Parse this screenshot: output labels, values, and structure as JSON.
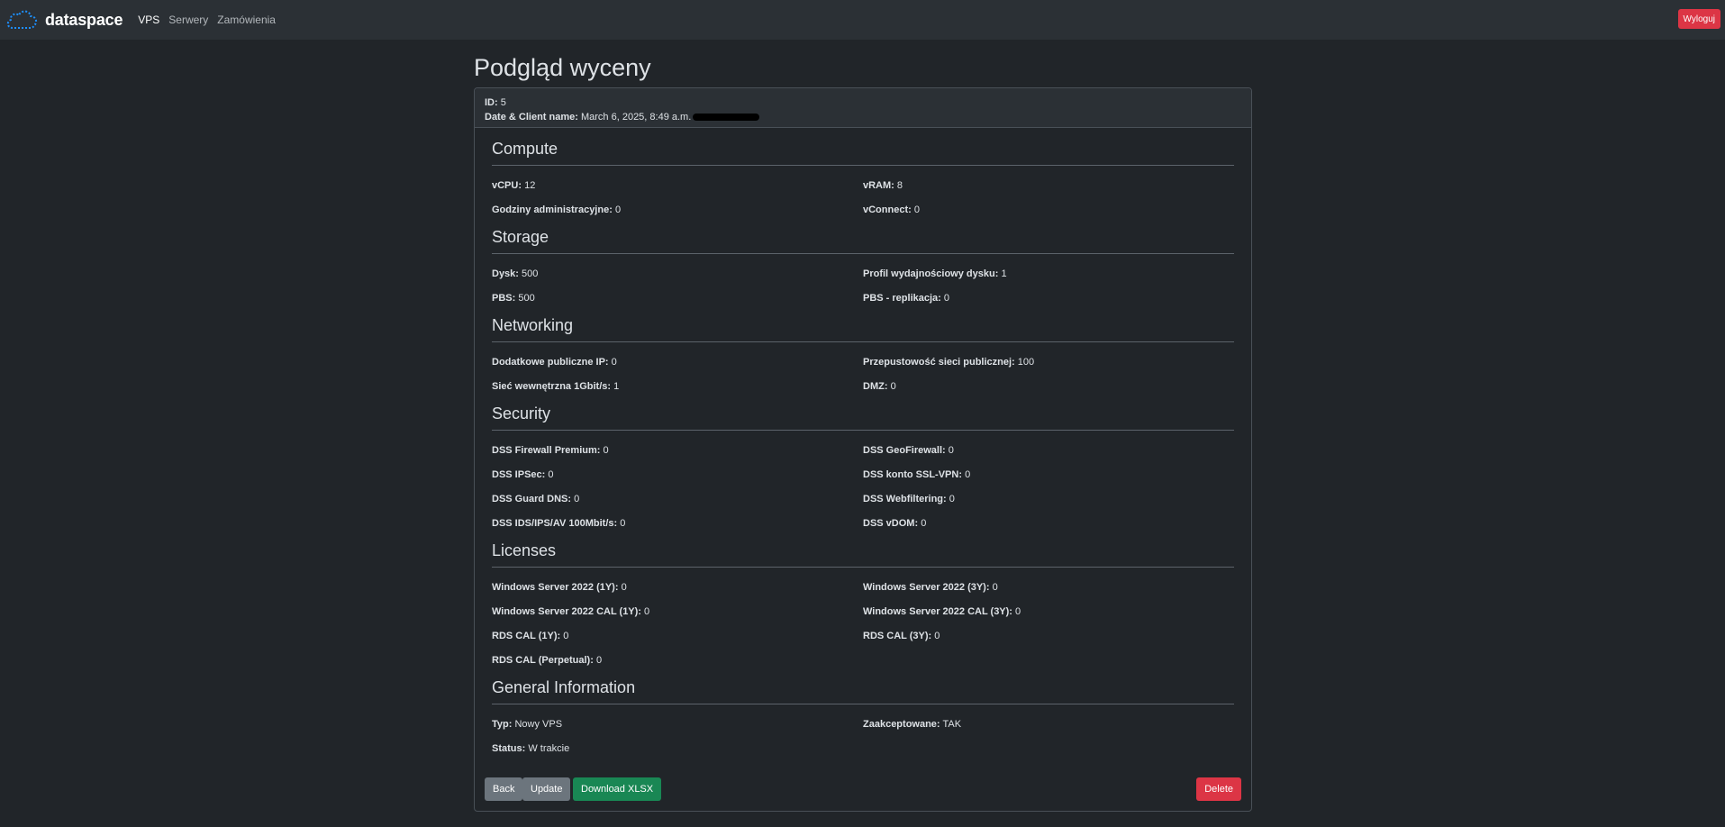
{
  "navbar": {
    "brand": "dataspace",
    "links": [
      "VPS",
      "Serwery",
      "Zamówienia"
    ],
    "logout": "Wyloguj"
  },
  "page": {
    "title": "Podgląd wyceny"
  },
  "header": {
    "id_label": "ID:",
    "id_value": "5",
    "date_label": "Date & Client name:",
    "date_value": "March 6, 2025, 8:49 a.m."
  },
  "sections": [
    {
      "title": "Compute",
      "rows": [
        [
          {
            "label": "vCPU:",
            "value": "12"
          },
          {
            "label": "vRAM:",
            "value": "8"
          }
        ],
        [
          {
            "label": "Godziny administracyjne:",
            "value": "0"
          },
          {
            "label": "vConnect:",
            "value": "0"
          }
        ]
      ]
    },
    {
      "title": "Storage",
      "rows": [
        [
          {
            "label": "Dysk:",
            "value": "500"
          },
          {
            "label": "Profil wydajnościowy dysku:",
            "value": "1"
          }
        ],
        [
          {
            "label": "PBS:",
            "value": "500"
          },
          {
            "label": "PBS - replikacja:",
            "value": "0"
          }
        ]
      ]
    },
    {
      "title": "Networking",
      "rows": [
        [
          {
            "label": "Dodatkowe publiczne IP:",
            "value": "0"
          },
          {
            "label": "Przepustowość sieci publicznej:",
            "value": "100"
          }
        ],
        [
          {
            "label": "Sieć wewnętrzna 1Gbit/s:",
            "value": "1"
          },
          {
            "label": "DMZ:",
            "value": "0"
          }
        ]
      ]
    },
    {
      "title": "Security",
      "rows": [
        [
          {
            "label": "DSS Firewall Premium:",
            "value": "0"
          },
          {
            "label": "DSS GeoFirewall:",
            "value": "0"
          }
        ],
        [
          {
            "label": "DSS IPSec:",
            "value": "0"
          },
          {
            "label": "DSS konto SSL-VPN:",
            "value": "0"
          }
        ],
        [
          {
            "label": "DSS Guard DNS:",
            "value": "0"
          },
          {
            "label": "DSS Webfiltering:",
            "value": "0"
          }
        ],
        [
          {
            "label": "DSS IDS/IPS/AV 100Mbit/s:",
            "value": "0"
          },
          {
            "label": "DSS vDOM:",
            "value": "0"
          }
        ]
      ]
    },
    {
      "title": "Licenses",
      "rows": [
        [
          {
            "label": "Windows Server 2022 (1Y):",
            "value": "0"
          },
          {
            "label": "Windows Server 2022 (3Y):",
            "value": "0"
          }
        ],
        [
          {
            "label": "Windows Server 2022 CAL (1Y):",
            "value": "0"
          },
          {
            "label": "Windows Server 2022 CAL (3Y):",
            "value": "0"
          }
        ],
        [
          {
            "label": "RDS CAL (1Y):",
            "value": "0"
          },
          {
            "label": "RDS CAL (3Y):",
            "value": "0"
          }
        ],
        [
          {
            "label": "RDS CAL (Perpetual):",
            "value": "0"
          }
        ]
      ]
    },
    {
      "title": "General Information",
      "rows": [
        [
          {
            "label": "Typ:",
            "value": "Nowy VPS"
          },
          {
            "label": "Zaakceptowane:",
            "value": "TAK"
          }
        ],
        [
          {
            "label": "Status:",
            "value": "W trakcie"
          }
        ]
      ]
    }
  ],
  "buttons": {
    "back": "Back",
    "update": "Update",
    "download": "Download XLSX",
    "delete": "Delete"
  },
  "colors": {
    "background": "#212529",
    "navbar": "#2b3035",
    "danger": "#dc3545",
    "success": "#198754",
    "secondary": "#6c757d",
    "logo": "#1e90ff"
  }
}
